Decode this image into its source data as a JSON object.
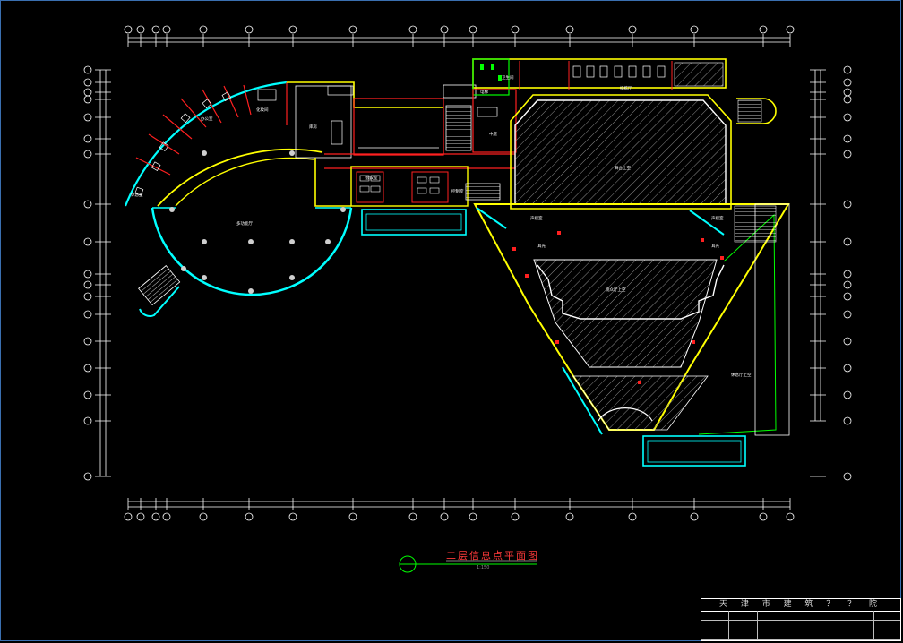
{
  "drawing": {
    "title": "二层信息点平面图",
    "scale": "1:150"
  },
  "rooms": {
    "room_a": "多功能厅",
    "room_b": "舞台上空",
    "room_c": "中庭",
    "room_d": "观众厅上空",
    "room_e": "库房",
    "room_f": "休息厅上空",
    "room_g": "耳光",
    "room_h": "声控室",
    "room_i": "电梯",
    "room_j": "控制室",
    "room_k": "卫生间",
    "room_l": "排练厅",
    "room_m": "化妆间",
    "room_n": "办公室",
    "room_o": "会议室",
    "room_p": "休息室"
  },
  "title_block": {
    "institute": "天 津 市 建 筑 ？ ？ 院"
  },
  "colors": {
    "axis": "#ffffff",
    "wall_yellow": "#ffff00",
    "wall_cyan": "#00ffff",
    "wall_red": "#ff2020",
    "hatch": "#9a9a9a",
    "green": "#00ff00",
    "title": "#ff3a3a"
  }
}
